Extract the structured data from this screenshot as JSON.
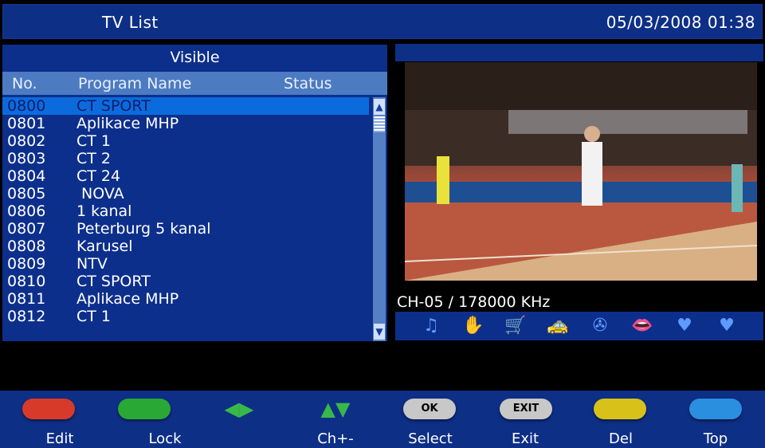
{
  "header": {
    "title": "TV List",
    "datetime": "05/03/2008 01:38"
  },
  "list": {
    "group": "Visible",
    "columns": {
      "no": "No.",
      "name": "Program Name",
      "status": "Status"
    },
    "rows": [
      {
        "no": "0800",
        "name": "CT SPORT",
        "selected": true
      },
      {
        "no": "0801",
        "name": "Aplikace MHP"
      },
      {
        "no": "0802",
        "name": "CT 1"
      },
      {
        "no": "0803",
        "name": "CT 2"
      },
      {
        "no": "0804",
        "name": "CT 24"
      },
      {
        "no": "0805",
        "name": " NOVA"
      },
      {
        "no": "0806",
        "name": "1 kanal"
      },
      {
        "no": "0807",
        "name": "Peterburg 5 kanal"
      },
      {
        "no": "0808",
        "name": "Karusel"
      },
      {
        "no": "0809",
        "name": "NTV"
      },
      {
        "no": "0810",
        "name": "CT SPORT"
      },
      {
        "no": "0811",
        "name": "Aplikace MHP"
      },
      {
        "no": "0812",
        "name": "CT 1"
      }
    ]
  },
  "preview": {
    "channel_info": "CH-05 / 178000 KHz"
  },
  "category_icons": [
    "music-icon",
    "news-icon",
    "shopping-cart-icon",
    "car-icon",
    "film-reel-icon",
    "lips-icon",
    "favorite-1-icon",
    "favorite-2-icon"
  ],
  "footer": {
    "buttons": [
      {
        "label": "Edit",
        "color": "#d83a2a",
        "key_text": ""
      },
      {
        "label": "Lock",
        "color": "#2aa836",
        "key_text": ""
      },
      {
        "label": "",
        "color": "",
        "key_text": ""
      },
      {
        "label": "Ch+-",
        "color": "",
        "key_text": ""
      },
      {
        "label": "Select",
        "color": "#c8c8c8",
        "key_text": "OK"
      },
      {
        "label": "Exit",
        "color": "#c8c8c8",
        "key_text": "EXIT"
      },
      {
        "label": "Del",
        "color": "#d8c21a",
        "key_text": ""
      },
      {
        "label": "Top",
        "color": "#2b8fe0",
        "key_text": ""
      }
    ]
  },
  "colors": {
    "panel": "#0d2f8c",
    "highlight": "#0c6bdc",
    "header": "#4d7bc1"
  }
}
